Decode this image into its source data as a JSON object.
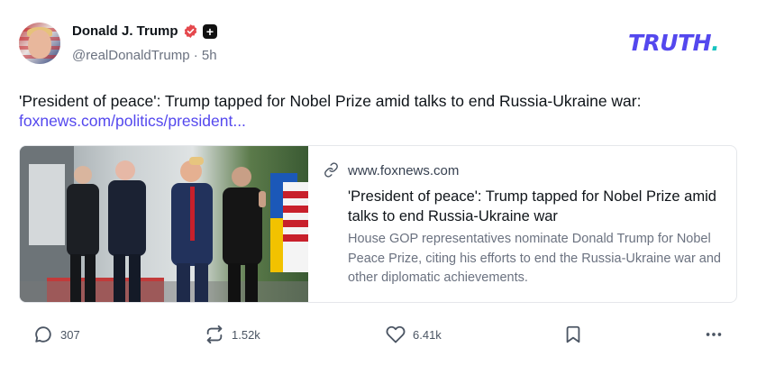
{
  "post": {
    "author_name": "Donald J. Trump",
    "handle": "@realDonaldTrump",
    "separator": "·",
    "time_ago": "5h",
    "text": "'President of peace': Trump tapped for Nobel Prize amid talks to end Russia-Ukraine war:",
    "link_text": "foxnews.com/politics/president..."
  },
  "brand": {
    "logo_text": "TRUTH",
    "logo_dot": ".",
    "accent_color": "#5448ee",
    "dot_color": "#17c3c0",
    "verified_color": "#e5484d"
  },
  "card": {
    "domain": "www.foxnews.com",
    "title": "'President of peace': Trump tapped for Nobel Prize amid talks to end Russia-Ukraine war",
    "description": "House GOP representatives nominate Donald Trump for Nobel Peace Prize, citing his efforts to end the Russia-Ukraine war and other diplomatic achievements."
  },
  "actions": {
    "replies": "307",
    "retruths": "1.52k",
    "likes": "6.41k"
  },
  "icons": [
    "verified-badge-icon",
    "plus-badge-icon",
    "link-icon",
    "reply-icon",
    "retruth-icon",
    "heart-icon",
    "bookmark-icon",
    "more-icon"
  ]
}
